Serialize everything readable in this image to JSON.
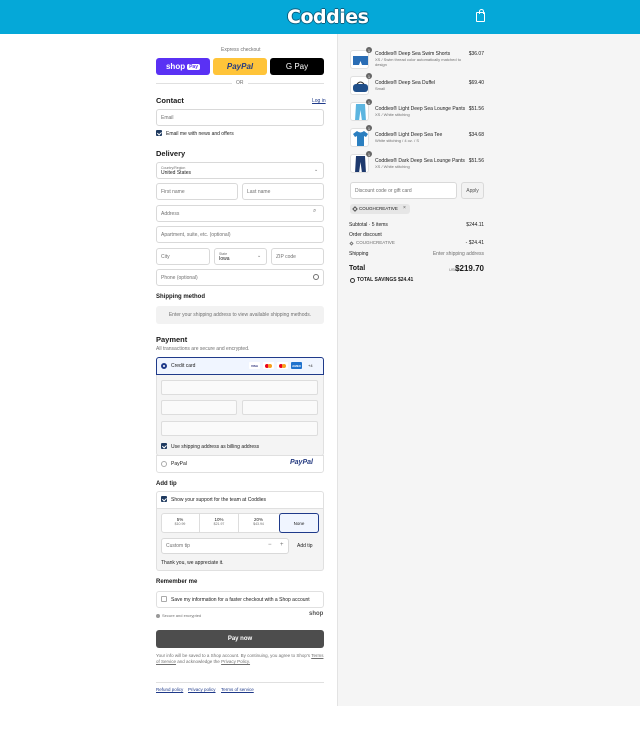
{
  "brand": {
    "name": "Coddies",
    "accent": "#05a8d8"
  },
  "express": {
    "label": "Express checkout",
    "shop_label": "shop",
    "shop_pay": "Pay",
    "paypal_label": "PayPal",
    "gpay_label": "G Pay",
    "or": "OR"
  },
  "contact": {
    "title": "Contact",
    "login": "Log in",
    "email_placeholder": "Email",
    "news_label": "Email me with news and offers"
  },
  "delivery": {
    "title": "Delivery",
    "country_label": "Country/Region",
    "country_value": "United States",
    "first_name": "First name",
    "last_name": "Last name",
    "address": "Address",
    "apartment": "Apartment, suite, etc. (optional)",
    "city": "City",
    "state_label": "State",
    "state_value": "Iowa",
    "zip": "ZIP code",
    "phone": "Phone (optional)"
  },
  "shipping_method": {
    "title": "Shipping method",
    "message": "Enter your shipping address to view available shipping methods."
  },
  "payment": {
    "title": "Payment",
    "subtitle": "All transactions are secure and encrypted.",
    "credit_card": "Credit card",
    "cards": [
      "VISA",
      "MC",
      "M",
      "AMEX"
    ],
    "more_cards": "+4",
    "billing_label": "Use shipping address as billing address",
    "paypal": "PayPal",
    "paypal_logo": "PayPal"
  },
  "tip": {
    "title": "Add tip",
    "support_label": "Show your support for the team at Coddies",
    "options": [
      {
        "pct": "5%",
        "amt": "$10.99"
      },
      {
        "pct": "10%",
        "amt": "$21.97"
      },
      {
        "pct": "20%",
        "amt": "$43.94"
      },
      {
        "pct": "None",
        "amt": ""
      }
    ],
    "custom_placeholder": "Custom tip",
    "minus": "−",
    "plus": "+",
    "add": "Add tip",
    "thanks": "Thank you, we appreciate it."
  },
  "remember": {
    "title": "Remember me",
    "save_label": "Save my information for a faster checkout with a Shop account",
    "secure": "Secure and encrypted",
    "shop": "shop"
  },
  "pay_now": "Pay now",
  "legal": {
    "line1": "Your info will be saved to a Shop account. By continuing, you agree to Shop's",
    "tos": "Terms of Service",
    "and": "and acknowledge the",
    "privacy": "Privacy Policy."
  },
  "footer": {
    "refund": "Refund policy",
    "privacy": "Privacy policy",
    "terms": "Terms of service"
  },
  "items": [
    {
      "qty": "1",
      "name": "Coddies® Deep Sea Swim Shorts",
      "variant": "XS / Swim thread color automatically matched to design",
      "price": "$36.07"
    },
    {
      "qty": "1",
      "name": "Coddies® Deep Sea Duffel",
      "variant": "Small",
      "price": "$69.40"
    },
    {
      "qty": "1",
      "name": "Coddies® Light Deep Sea Lounge Pants",
      "variant": "XS / White stitching",
      "price": "$51.56"
    },
    {
      "qty": "1",
      "name": "Coddies® Light Deep Sea Tee",
      "variant": "White stitching / 4 oz. / S",
      "price": "$34.68"
    },
    {
      "qty": "1",
      "name": "Coddies® Dark Deep Sea Lounge Pants",
      "variant": "XS / White stitching",
      "price": "$51.56"
    }
  ],
  "discount": {
    "placeholder": "Discount code or gift card",
    "apply": "Apply",
    "code": "COUGHCREATIVE"
  },
  "summary": {
    "subtotal_label": "Subtotal · 5 items",
    "subtotal": "$244.11",
    "order_discount": "Order discount",
    "discount_code": "COUGHCREATIVE",
    "discount_amount": "- $24.41",
    "shipping_label": "Shipping",
    "shipping_value": "Enter shipping address",
    "total_label": "Total",
    "currency": "USD",
    "total": "$219.70",
    "savings_label": "TOTAL SAVINGS",
    "savings": "$24.41"
  }
}
